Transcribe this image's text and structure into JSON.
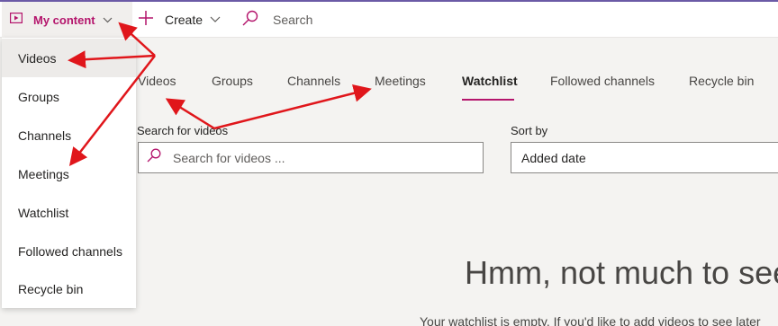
{
  "topbar": {
    "my_content_label": "My content",
    "create_label": "Create",
    "search_label": "Search"
  },
  "dropdown": {
    "items": [
      "Videos",
      "Groups",
      "Channels",
      "Meetings",
      "Watchlist",
      "Followed channels",
      "Recycle bin"
    ],
    "selected": "Videos"
  },
  "tabs": {
    "items": [
      "Videos",
      "Groups",
      "Channels",
      "Meetings",
      "Watchlist",
      "Followed channels",
      "Recycle bin"
    ],
    "active": "Watchlist"
  },
  "filters": {
    "search_label": "Search for videos",
    "search_placeholder": "Search for videos ...",
    "sort_label": "Sort by",
    "sort_value": "Added date"
  },
  "empty_state": {
    "title": "Hmm, not much to see",
    "description": "Your watchlist is empty. If you'd like to add videos to see later"
  },
  "colors": {
    "accent": "#b4156c",
    "top_line": "#6b5aa6",
    "annotation_arrow": "#e0161b"
  },
  "icons": {
    "my_content": "video-library-icon",
    "create": "plus-icon",
    "search": "search-icon",
    "dropdown_caret": "chevron-down-icon"
  }
}
